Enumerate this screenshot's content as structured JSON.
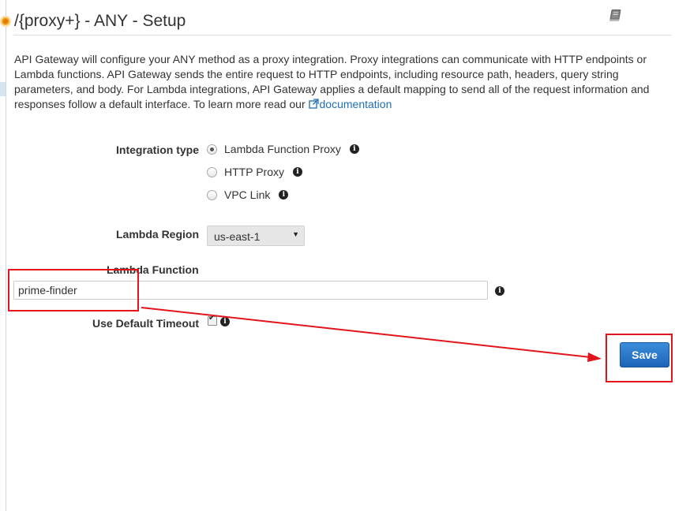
{
  "header": {
    "title": "/{proxy+} - ANY - Setup",
    "icon": "book-icon"
  },
  "description": {
    "text": "API Gateway will configure your ANY method as a proxy integration. Proxy integrations can communicate with HTTP endpoints or Lambda functions. API Gateway sends the entire request to HTTP endpoints, including resource path, headers, query string parameters, and body. For Lambda integrations, API Gateway applies a default mapping to send all of the request information and responses follow a default interface. To learn more read our ",
    "link_label": "documentation"
  },
  "form": {
    "integration_type_label": "Integration type",
    "integration_options": [
      {
        "label": "Lambda Function Proxy",
        "selected": true
      },
      {
        "label": "HTTP Proxy",
        "selected": false
      },
      {
        "label": "VPC Link",
        "selected": false
      }
    ],
    "lambda_region_label": "Lambda Region",
    "lambda_region_value": "us-east-1",
    "lambda_function_label": "Lambda Function",
    "lambda_function_value": "prime-finder",
    "use_default_timeout_label": "Use Default Timeout",
    "use_default_timeout_checked": true
  },
  "actions": {
    "save_label": "Save"
  },
  "colors": {
    "link": "#1f6fb2",
    "primary_button": "#1d64b8",
    "annotation": "#e3141a",
    "status_dot": "#f5a623"
  }
}
